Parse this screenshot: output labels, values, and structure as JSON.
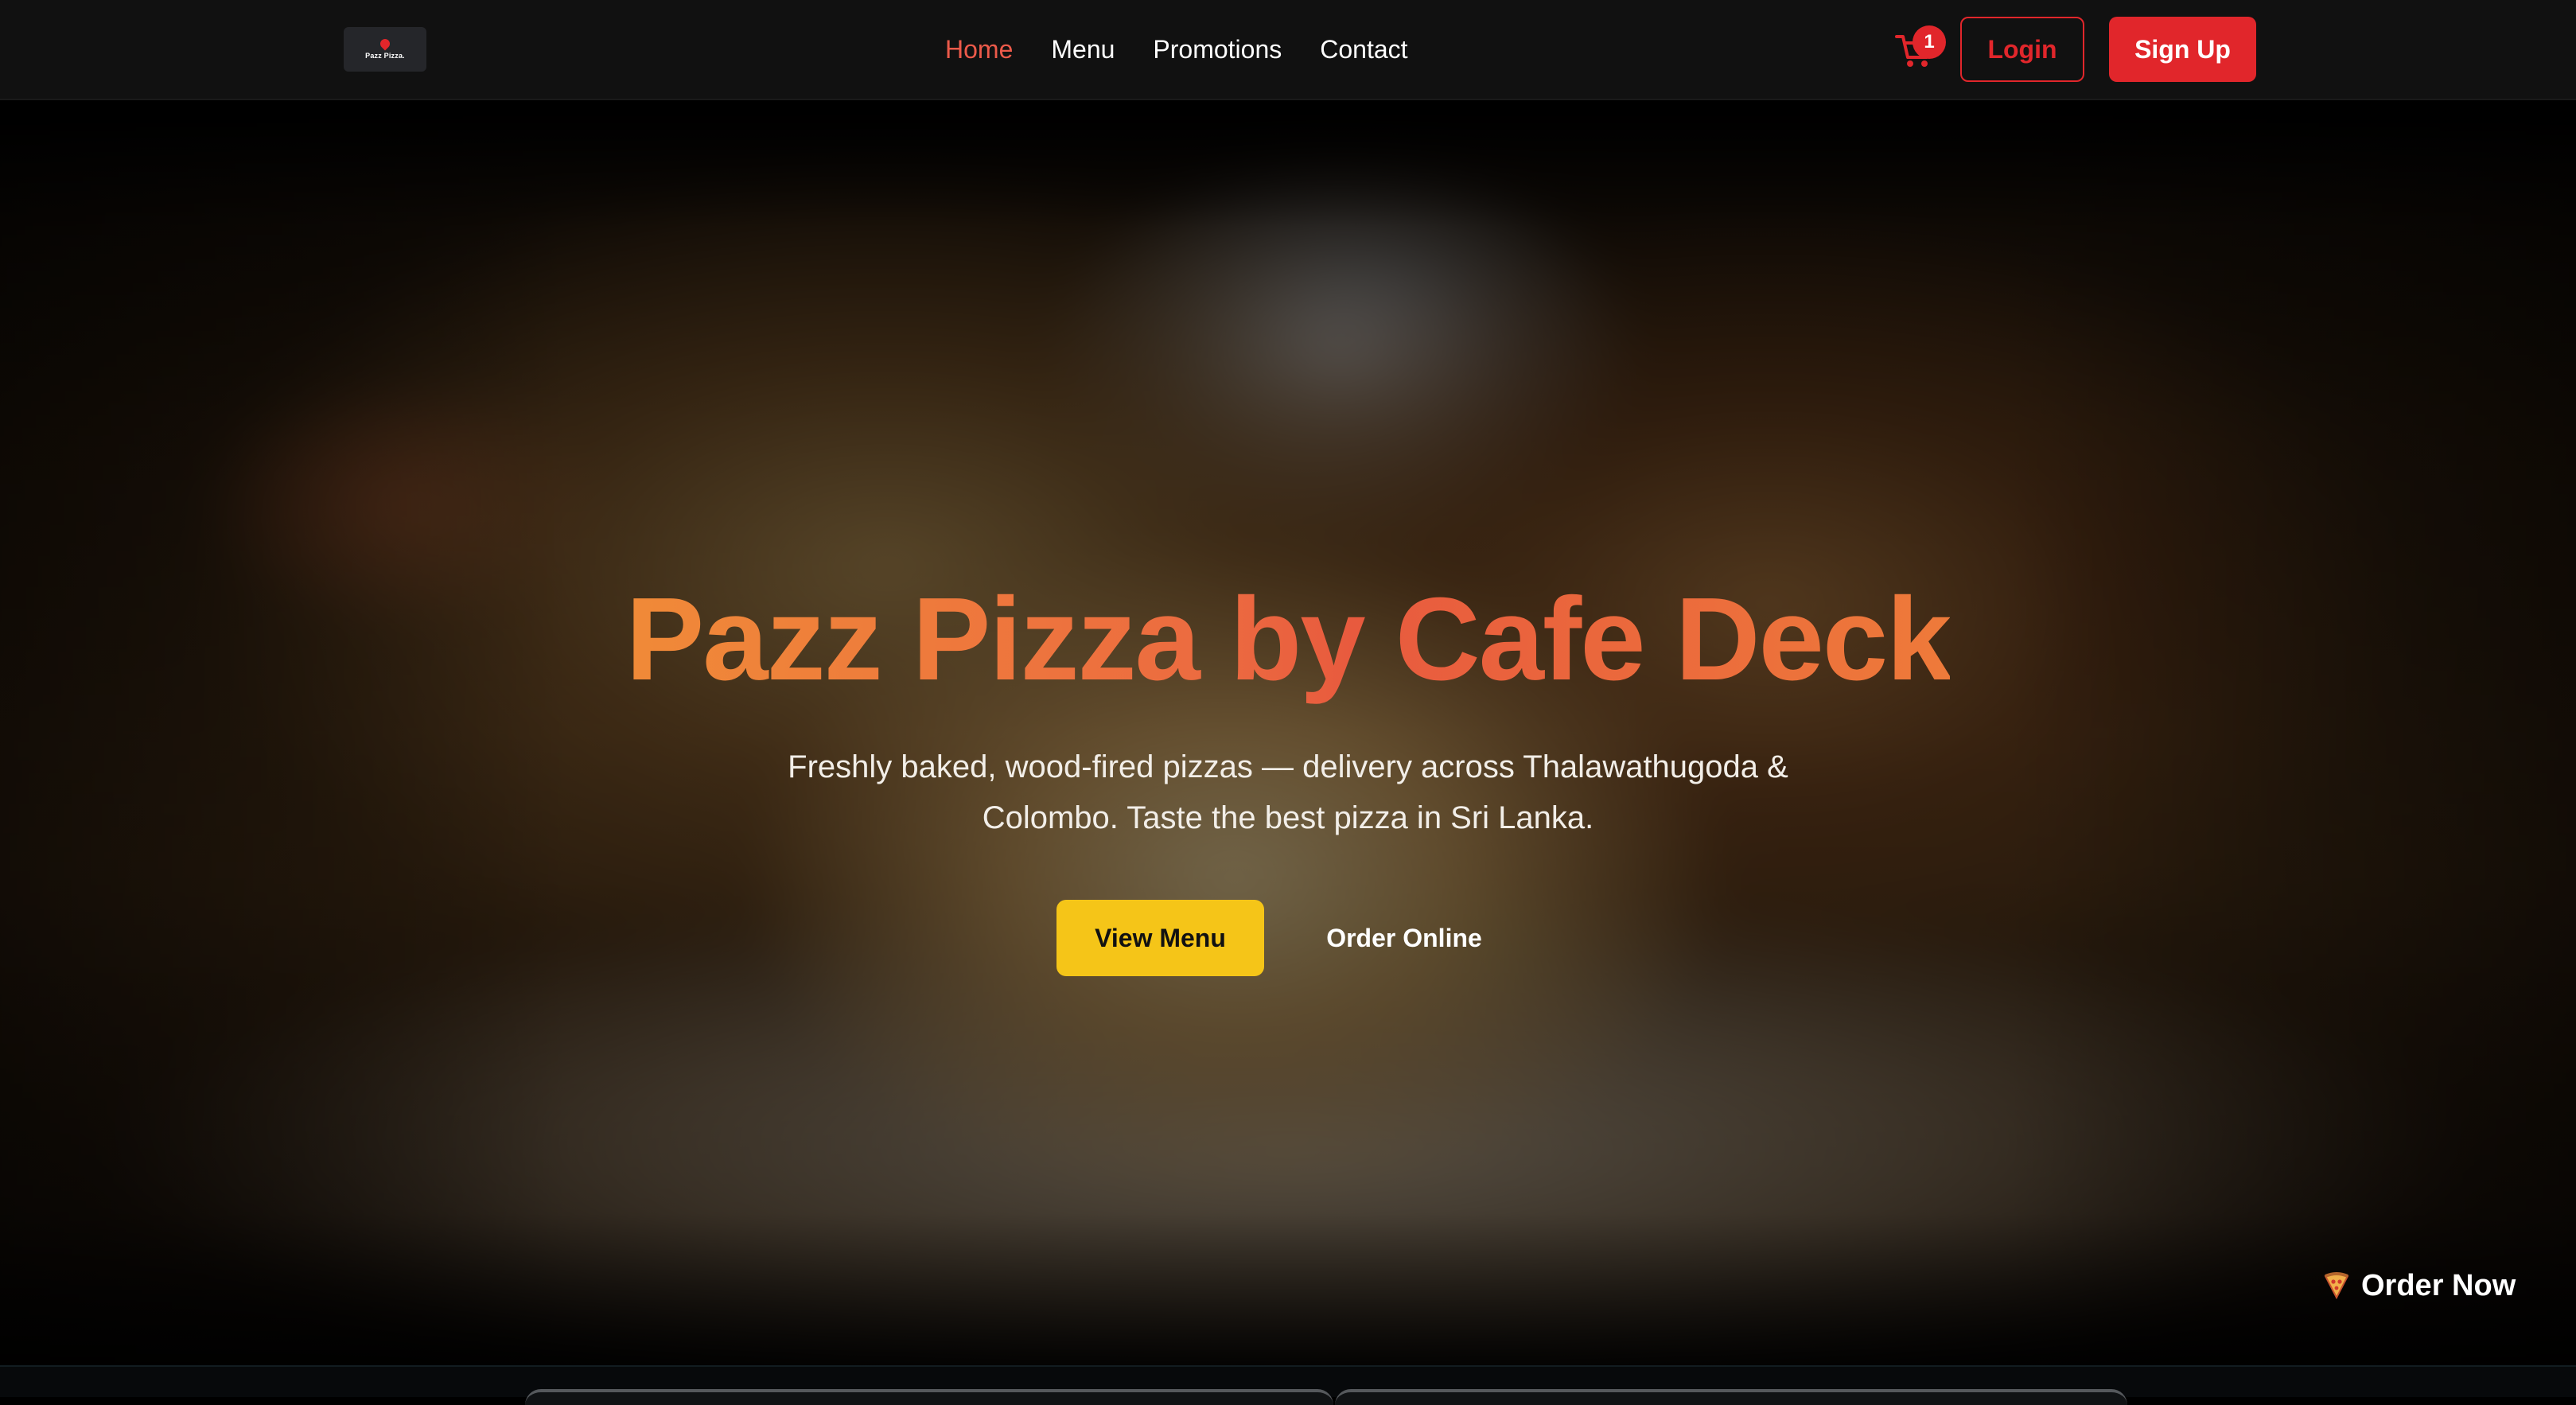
{
  "brand": {
    "logo_text": "Pazz Pizza."
  },
  "nav": {
    "links": [
      {
        "label": "Home",
        "active": true
      },
      {
        "label": "Menu",
        "active": false
      },
      {
        "label": "Promotions",
        "active": false
      },
      {
        "label": "Contact",
        "active": false
      }
    ],
    "cart_count": "1",
    "login_label": "Login",
    "signup_label": "Sign Up"
  },
  "hero": {
    "title": "Pazz Pizza by Cafe Deck",
    "subtitle": "Freshly baked, wood-fired pizzas — delivery across Thalawathugoda & Colombo. Taste the best pizza in Sri Lanka.",
    "primary_cta": "View Menu",
    "secondary_cta": "Order Online"
  },
  "floating": {
    "order_now_label": "Order Now",
    "icon": "pizza-slice-icon"
  },
  "colors": {
    "accent_red": "#e1262b",
    "cta_yellow": "#f5c518",
    "title_orange": "#f08a38",
    "nav_active": "#ec5a4a",
    "navbar_bg": "#111111"
  }
}
